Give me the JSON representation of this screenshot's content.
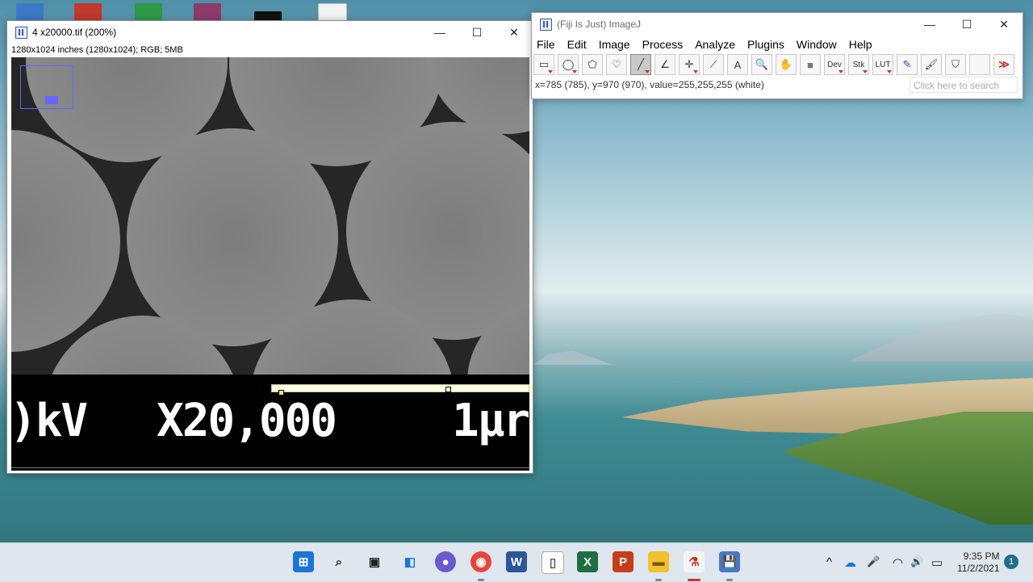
{
  "colors": {
    "accent": "#6b63ff",
    "taskbar": "#dfe6ee",
    "scale_bar_outline": "#cfcf3a"
  },
  "image_window": {
    "title": "4 x20000.tif (200%)",
    "info": "1280x1024 inches (1280x1024); RGB; 5MB",
    "controls": {
      "minimize": "—",
      "maximize": "☐",
      "close": "✕"
    },
    "overlay": {
      "kv_text": ")kV",
      "mag_text": "X20,000",
      "scale_text": "1µr"
    }
  },
  "fiji_window": {
    "title": "(Fiji Is Just) ImageJ",
    "controls": {
      "minimize": "—",
      "maximize": "☐",
      "close": "✕"
    },
    "menu": [
      "File",
      "Edit",
      "Image",
      "Process",
      "Analyze",
      "Plugins",
      "Window",
      "Help"
    ],
    "tools": {
      "rectangle": "▭",
      "oval": "◯",
      "polygon": "⬠",
      "freehand": "♡",
      "line": "╱",
      "angle": "∠",
      "point": "✛",
      "wand": "⟋",
      "text": "A",
      "zoom": "🔍",
      "hand": "✋",
      "color": "■",
      "dev": "Dev",
      "stk": "Stk",
      "lut": "LUT",
      "pencil": "✎",
      "brush": "🖌",
      "flood": "⛉",
      "blank": "",
      "more": "≫"
    },
    "status": "x=785 (785), y=970 (970), value=255,255,255 (white)",
    "search_placeholder": "Click here to search"
  },
  "taskbar": {
    "icons": {
      "start": "⊞",
      "search": "⌕",
      "taskview": "▣",
      "widgets": "◧",
      "chat": "●",
      "chrome": "◉",
      "word": "W",
      "file": "▯",
      "excel": "X",
      "powerpoint": "P",
      "explorer": "▬",
      "fiji": "⚗",
      "save": "💾"
    },
    "tray": {
      "chevron": "^",
      "onedrive": "☁",
      "mic": "🎤",
      "wifi": "◠",
      "volume": "🔊",
      "battery": "▭"
    },
    "time": "9:35 PM",
    "date": "11/2/2021",
    "notification_count": "1"
  }
}
